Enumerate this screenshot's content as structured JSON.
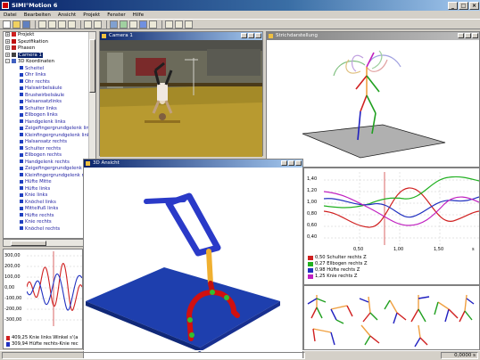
{
  "app": {
    "title": "SIMI°Motion 6"
  },
  "menu": [
    "Datei",
    "Bearbeiten",
    "Ansicht",
    "Projekt",
    "Fenster",
    "Hilfe"
  ],
  "tree": {
    "top_items": [
      "Projekt",
      "Spezifikation",
      "Phasen",
      "Camera 1",
      "3D Koordinaten"
    ],
    "selected": "Camera 1",
    "points": [
      "Scheitel",
      "Ohr links",
      "Ohr rechts",
      "Halswirbelsäule",
      "Brustwirbelsäule",
      "Halsansatzlinks",
      "Schulter links",
      "Ellbogen links",
      "Handgelenk links",
      "Zeigefingergrundgelenk links",
      "Kleinfingergrundgelenk links",
      "Halsansatz rechts",
      "Schulter rechts",
      "Ellbogen rechts",
      "Handgelenk rechts",
      "Zeigefingergrundgelenk rechts",
      "Kleinfingergrundgelenk rechts",
      "Hüfte Mitte",
      "Hüfte links",
      "Knie links",
      "Knöchel links",
      "Mittelfuß links",
      "Hüfte rechts",
      "Knie rechts",
      "Knöchel rechts"
    ]
  },
  "windows": {
    "camera": "Camera 1",
    "stick": "Strichdarstellung",
    "view3d": "3D Ansicht"
  },
  "graph_right": {
    "y_ticks": [
      "1,40",
      "1,20",
      "1,00",
      "0,80",
      "0,60",
      "0,40"
    ],
    "x_ticks": [
      "0,50",
      "1,00",
      "1,50",
      "s"
    ],
    "legend": [
      {
        "color": "#d02020",
        "text": "0,50 Schulter rechts  Z"
      },
      {
        "color": "#20b020",
        "text": "0,27 Ellbogen rechts  Z"
      },
      {
        "color": "#2030c0",
        "text": "0,98 Hüfte rechts  Z"
      },
      {
        "color": "#c020c0",
        "text": "1,25 Knie rechts  Z"
      }
    ]
  },
  "graph_left": {
    "y_ticks": [
      "300,00",
      "200,00",
      "100,00",
      "0,00",
      "-100,00",
      "-200,00",
      "-300,00"
    ],
    "legend": [
      {
        "color": "#d02020",
        "text": "409,25 Knie links  Winkel  s'(a"
      },
      {
        "color": "#2030c0",
        "text": "309,94 Hüfte rechts-Knie rec"
      }
    ]
  },
  "status": {
    "time": "0,0000 s"
  },
  "colors": {
    "titlebar": "#0a246a",
    "floor": "#1e3fae",
    "skeleton_red": "#d01010",
    "skeleton_orange": "#f0b030",
    "skeleton_blue": "#2020c0"
  }
}
